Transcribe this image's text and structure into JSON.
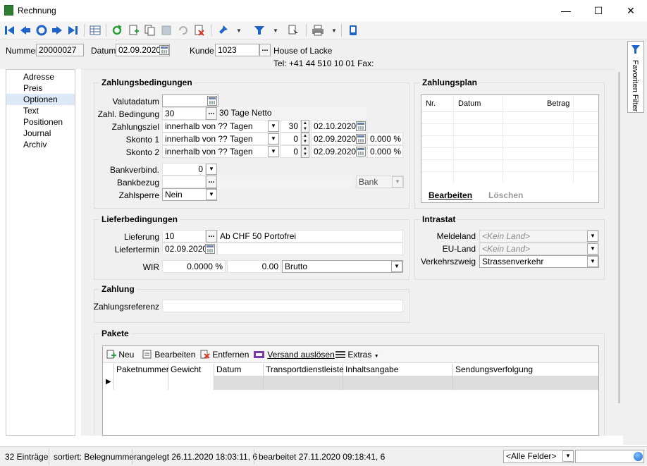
{
  "window": {
    "title": "Rechnung"
  },
  "header": {
    "nummer_label": "Nummer",
    "nummer_value": "20000027",
    "datum_label": "Datum",
    "datum_value": "02.09.2020",
    "kunde_label": "Kunde",
    "kunde_value": "1023",
    "kunde_name": "House of Lacke",
    "contact": "Tel: +41 44 510 10 01   Fax:"
  },
  "nav": {
    "items": [
      {
        "label": "Adresse"
      },
      {
        "label": "Preis"
      },
      {
        "label": "Optionen",
        "selected": true
      },
      {
        "label": "Text"
      },
      {
        "label": "Positionen"
      },
      {
        "label": "Journal"
      },
      {
        "label": "Archiv"
      }
    ]
  },
  "zahlungsbedingungen": {
    "title": "Zahlungsbedingungen",
    "valutadatum_label": "Valutadatum",
    "valutadatum_value": "",
    "bedingung_label": "Zahl. Bedingung",
    "bedingung_value": "30",
    "bedingung_text": "30 Tage Netto",
    "ziel_label": "Zahlungsziel",
    "ziel_mode": "innerhalb von ?? Tagen",
    "ziel_days": "30",
    "ziel_date": "02.10.2020",
    "skonto1_label": "Skonto 1",
    "skonto1_mode": "innerhalb von ?? Tagen",
    "skonto1_days": "0",
    "skonto1_date": "02.09.2020",
    "skonto1_pct": "0.000 %",
    "skonto2_label": "Skonto 2",
    "skonto2_mode": "innerhalb von ?? Tagen",
    "skonto2_days": "0",
    "skonto2_date": "02.09.2020",
    "skonto2_pct": "0.000 %",
    "bankverbind_label": "Bankverbind.",
    "bankverbind_value": "0",
    "bankbezug_label": "Bankbezug",
    "bank_value": "Bank",
    "zahlsperre_label": "Zahlsperre",
    "zahlsperre_value": "Nein"
  },
  "zahlungsplan": {
    "title": "Zahlungsplan",
    "columns": [
      "Nr.",
      "Datum",
      "Betrag"
    ],
    "edit_label": "Bearbeiten",
    "delete_label": "Löschen"
  },
  "lieferbedingungen": {
    "title": "Lieferbedingungen",
    "lieferung_label": "Lieferung",
    "lieferung_value": "10",
    "lieferung_text": "Ab CHF 50 Portofrei",
    "liefertermin_label": "Liefertermin",
    "liefertermin_value": "02.09.2020",
    "wir_label": "WIR",
    "wir_pct": "0.0000 %",
    "wir_amount": "0.00",
    "wir_mode": "Brutto"
  },
  "intrastat": {
    "title": "Intrastat",
    "meldeland_label": "Meldeland",
    "meldeland_value": "<Kein Land>",
    "euland_label": "EU-Land",
    "euland_value": "<Kein Land>",
    "verkehr_label": "Verkehrszweig",
    "verkehr_value": "Strassenverkehr"
  },
  "zahlung": {
    "title": "Zahlung",
    "referenz_label": "Zahlungsreferenz",
    "referenz_value": ""
  },
  "pakete": {
    "title": "Pakete",
    "toolbar": {
      "new": "Neu",
      "edit": "Bearbeiten",
      "remove": "Entfernen",
      "ship": "Versand auslösen",
      "extras": "Extras"
    },
    "columns": [
      "Paketnummer",
      "Gewicht",
      "Datum",
      "Transportdienstleister",
      "Inhaltsangabe",
      "Sendungsverfolgung"
    ]
  },
  "sidebar": {
    "favorites": "Favoriten Filter"
  },
  "status": {
    "count": "32 Einträge",
    "sorted": "sortiert: Belegnummer",
    "created": "angelegt 26.11.2020 18:03:11,  6",
    "edited": "bearbeitet 27.11.2020 09:18:41,  6",
    "filter_value": "<Alle Felder>"
  },
  "colors": {
    "accent": "#1e64c8",
    "selected_nav": "#dce8f6",
    "panel": "#f0f0f0"
  }
}
